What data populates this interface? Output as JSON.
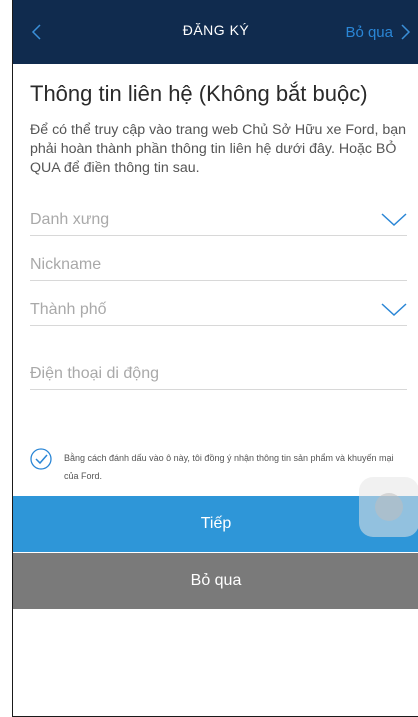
{
  "header": {
    "title": "ĐĂNG KÝ",
    "skip_label": "Bỏ qua"
  },
  "main": {
    "title": "Thông tin liên hệ (Không bắt buộc)",
    "description": "Để có thể truy cập vào trang web Chủ Sở Hữu xe Ford, bạn phải hoàn thành phần thông tin liên hệ dưới đây. Hoặc BỎ QUA để điền thông tin sau.",
    "fields": {
      "salutation_placeholder": "Danh xưng",
      "nickname_placeholder": "Nickname",
      "city_placeholder": "Thành phố",
      "phone_placeholder": "Điện thoại di động"
    },
    "consent": {
      "checked": true,
      "text": "Bằng cách đánh dấu vào ô này, tôi đồng ý nhận thông tin sản phẩm và khuyến mại của Ford."
    }
  },
  "actions": {
    "continue_label": "Tiếp",
    "skip_label": "Bỏ qua"
  },
  "colors": {
    "header_bg": "#102b4e",
    "accent_blue": "#2e96d8",
    "skip_gray": "#7a7a7a"
  },
  "icons": {
    "back": "chevron-left-icon",
    "skip": "chevron-right-icon",
    "dropdown": "chevron-down-icon",
    "checkbox": "checkmark-circle-icon"
  }
}
